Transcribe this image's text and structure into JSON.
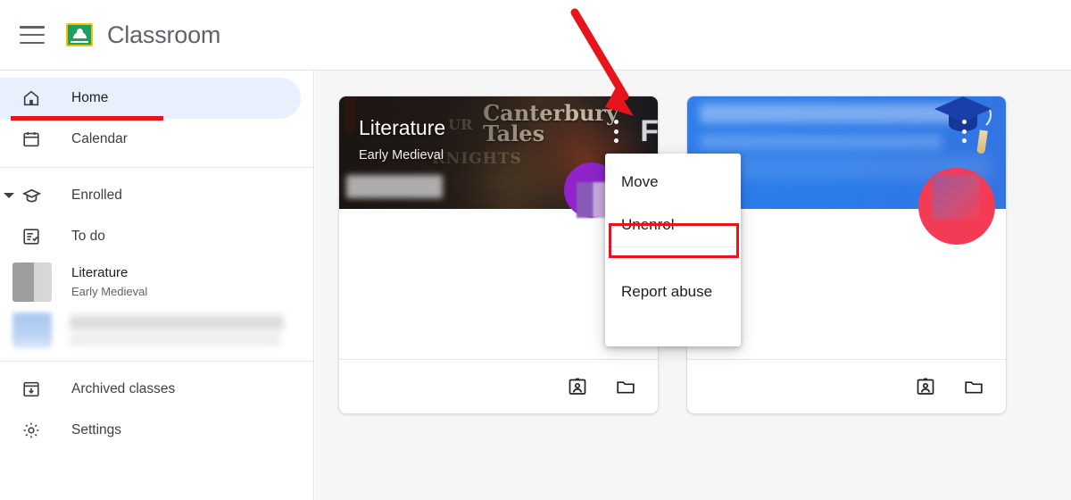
{
  "header": {
    "menu_icon": "hamburger-menu-icon",
    "logo_icon": "google-classroom-logo",
    "title": "Classroom"
  },
  "sidebar": {
    "primary": [
      {
        "icon": "home-icon",
        "label": "Home",
        "active": true
      },
      {
        "icon": "calendar-icon",
        "label": "Calendar",
        "active": false
      }
    ],
    "enrolled": {
      "icon": "graduation-cap-icon",
      "caret": "chevron-down-icon",
      "label": "Enrolled"
    },
    "todo": {
      "icon": "todo-checklist-icon",
      "label": "To do"
    },
    "classes": [
      {
        "name": "Literature",
        "section": "Early Medieval"
      },
      {
        "name": "",
        "section": ""
      }
    ],
    "footer": [
      {
        "icon": "archive-icon",
        "label": "Archived classes"
      },
      {
        "icon": "gear-icon",
        "label": "Settings"
      }
    ]
  },
  "cards": [
    {
      "title": "Literature",
      "subtitle": "Early Medieval",
      "banner_text_main": "Canterbury",
      "banner_text_second": "Tales",
      "banner_text_sub": "KNIGHTS",
      "banner_text_ur": "UR",
      "banner_letter": "F",
      "overflow_icon": "three-dot-menu-icon",
      "avatar": "purple-avatar",
      "footer_icons": [
        "assignment-card-icon",
        "folder-icon"
      ]
    },
    {
      "title": "",
      "subtitle": "",
      "overflow_icon": "three-dot-menu-icon",
      "avatar": "red-avatar",
      "footer_icons": [
        "assignment-card-icon",
        "folder-icon"
      ]
    }
  ],
  "dropdown": {
    "items": [
      {
        "label": "Move",
        "highlighted": false
      },
      {
        "label": "Unenrol",
        "highlighted": true
      },
      {
        "label": "Report abuse",
        "highlighted": false
      }
    ]
  },
  "annotations": {
    "color": "#e8141c",
    "arrow": "red-arrow-pointing-to-overflow-menu",
    "underline": "red-underline-under-home",
    "box": "red-box-around-unenrol"
  },
  "colors": {
    "accent_blue": "#e8f0fe",
    "annotation_red": "#e8141c",
    "logo_green": "#1e9e62",
    "logo_border": "#f4c300",
    "page_bg": "#f6f6f6"
  }
}
